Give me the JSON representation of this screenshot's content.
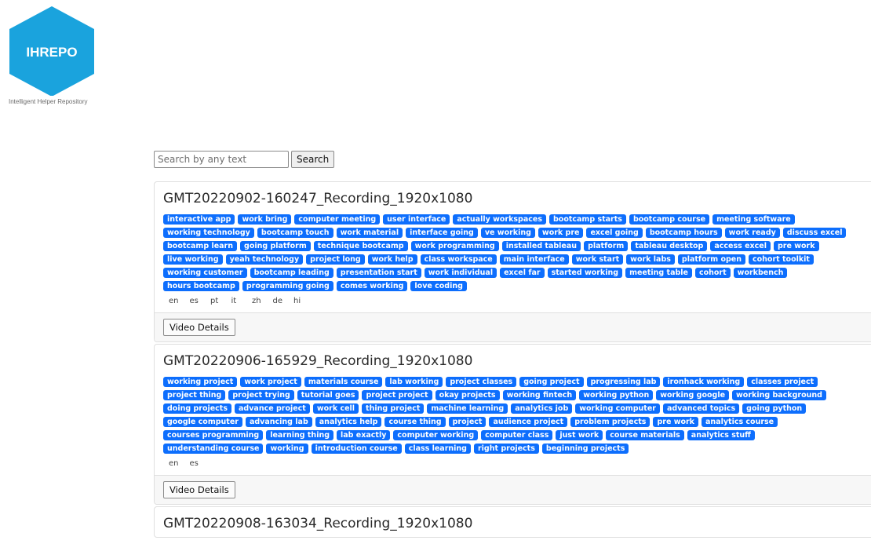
{
  "brand": {
    "logo_text": "IHREPO",
    "tagline": "Intelligent Helper Repository",
    "color": "#1aa3dd"
  },
  "search": {
    "placeholder": "Search by any text",
    "value": "",
    "button_label": "Search"
  },
  "accent_color": "#0d6efd",
  "recordings": [
    {
      "title": "GMT20220902-160247_Recording_1920x1080",
      "tags": [
        "interactive app",
        "work bring",
        "computer meeting",
        "user interface",
        "actually workspaces",
        "bootcamp starts",
        "bootcamp course",
        "meeting software",
        "working technology",
        "bootcamp touch",
        "work material",
        "interface going",
        "ve working",
        "work pre",
        "excel going",
        "bootcamp hours",
        "work ready",
        "discuss excel",
        "bootcamp learn",
        "going platform",
        "technique bootcamp",
        "work programming",
        "installed tableau",
        "platform",
        "tableau desktop",
        "access excel",
        "pre work",
        "live working",
        "yeah technology",
        "project long",
        "work help",
        "class workspace",
        "main interface",
        "work start",
        "work labs",
        "platform open",
        "cohort toolkit",
        "working customer",
        "bootcamp leading",
        "presentation start",
        "work individual",
        "excel far",
        "started working",
        "meeting table",
        "cohort",
        "workbench",
        "hours bootcamp",
        "programming going",
        "comes working",
        "love coding"
      ],
      "languages": [
        "en",
        "es",
        "pt",
        "it",
        "zh",
        "de",
        "hi"
      ],
      "details_label": "Video Details"
    },
    {
      "title": "GMT20220906-165929_Recording_1920x1080",
      "tags": [
        "working project",
        "work project",
        "materials course",
        "lab working",
        "project classes",
        "going project",
        "progressing lab",
        "ironhack working",
        "classes project",
        "project thing",
        "project trying",
        "tutorial goes",
        "project project",
        "okay projects",
        "working fintech",
        "working python",
        "working google",
        "working background",
        "doing projects",
        "advance project",
        "work cell",
        "thing project",
        "machine learning",
        "analytics job",
        "working computer",
        "advanced topics",
        "going python",
        "google computer",
        "advancing lab",
        "analytics help",
        "course thing",
        "project",
        "audience project",
        "problem projects",
        "pre work",
        "analytics course",
        "courses programming",
        "learning thing",
        "lab exactly",
        "computer working",
        "computer class",
        "just work",
        "course materials",
        "analytics stuff",
        "understanding course",
        "working",
        "introduction course",
        "class learning",
        "right projects",
        "beginning projects"
      ],
      "languages": [
        "en",
        "es"
      ],
      "details_label": "Video Details"
    },
    {
      "title": "GMT20220908-163034_Recording_1920x1080",
      "tags": [],
      "languages": [],
      "details_label": ""
    }
  ]
}
